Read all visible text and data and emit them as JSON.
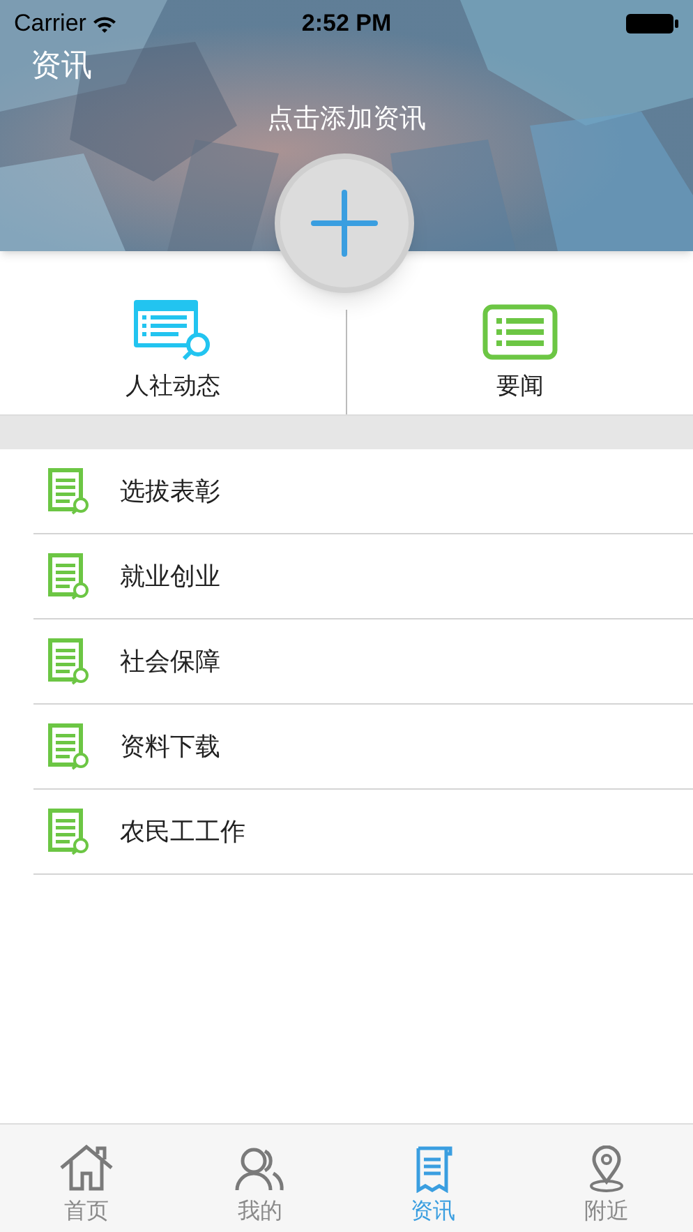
{
  "status_bar": {
    "carrier": "Carrier",
    "time": "2:52 PM"
  },
  "header": {
    "title": "资讯",
    "caption": "点击添加资讯"
  },
  "categories": [
    {
      "label": "人社动态",
      "kind": "search-list"
    },
    {
      "label": "要闻",
      "kind": "list"
    }
  ],
  "items": [
    {
      "label": "选拔表彰"
    },
    {
      "label": "就业创业"
    },
    {
      "label": "社会保障"
    },
    {
      "label": "资料下载"
    },
    {
      "label": "农民工工作"
    }
  ],
  "tabs": [
    {
      "label": "首页",
      "kind": "home",
      "selected": false
    },
    {
      "label": "我的",
      "kind": "people",
      "selected": false
    },
    {
      "label": "资讯",
      "kind": "news",
      "selected": true
    },
    {
      "label": "附近",
      "kind": "location",
      "selected": false
    }
  ]
}
